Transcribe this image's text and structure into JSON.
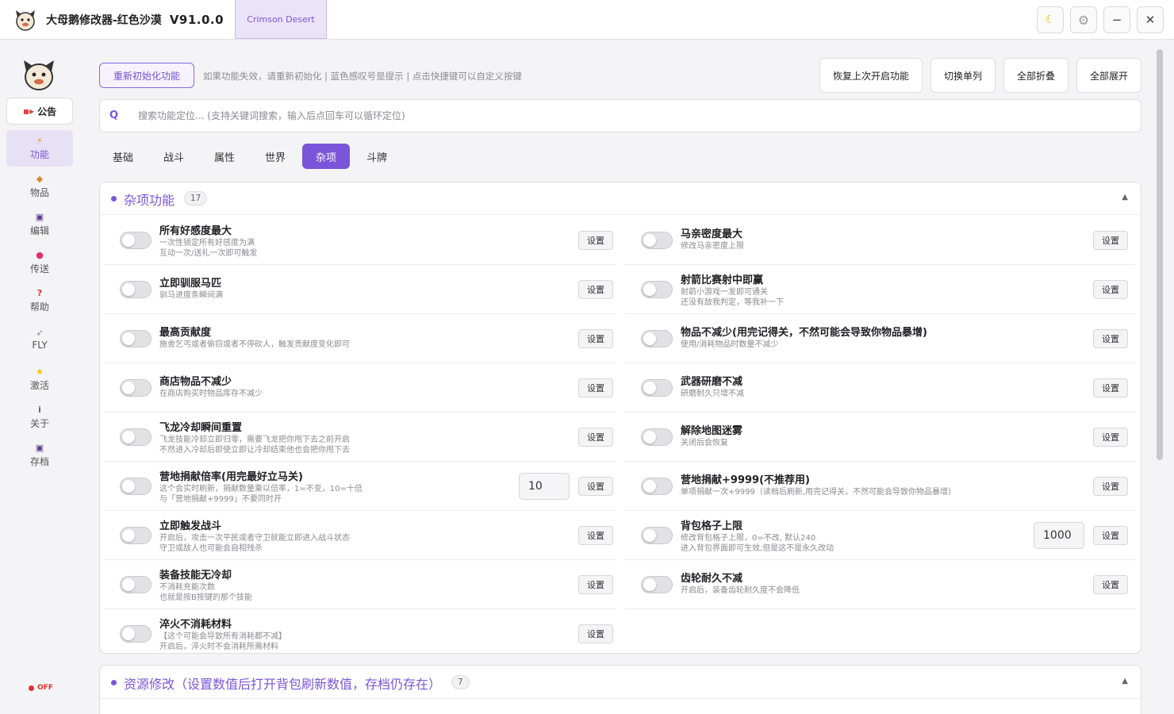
{
  "app": {
    "title": "大母鹅修改器-红色沙漠",
    "version": "V91.0.0",
    "game_tab": "Crimson Desert"
  },
  "window_controls": {
    "theme_icon": "moon-icon",
    "settings_icon": "gear-icon",
    "minimize_icon": "minimize-icon",
    "close_icon": "close-icon"
  },
  "sidebar": {
    "notice_label": "公告",
    "items": [
      {
        "label": "功能",
        "icon": "lightning-icon",
        "active": true
      },
      {
        "label": "物品",
        "icon": "box-icon",
        "active": false
      },
      {
        "label": "编辑",
        "icon": "floppy-icon",
        "active": false
      },
      {
        "label": "传送",
        "icon": "pin-icon",
        "active": false
      },
      {
        "label": "帮助",
        "icon": "question-icon",
        "active": false
      },
      {
        "label": "FLY",
        "icon": "feather-icon",
        "active": false
      },
      {
        "label": "激活",
        "icon": "star-icon",
        "active": false
      },
      {
        "label": "关于",
        "icon": "info-icon",
        "active": false
      },
      {
        "label": "存档",
        "icon": "floppy-icon",
        "active": false
      }
    ],
    "status": "OFF"
  },
  "toolbar": {
    "reinit_label": "重新初始化功能",
    "hint": "如果功能失效，请重新初始化 | 蓝色感叹号是提示 | 点击快捷键可以自定义按键",
    "restore_label": "恢复上次开启功能",
    "single_col_label": "切换单列",
    "collapse_all_label": "全部折叠",
    "expand_all_label": "全部展开"
  },
  "search": {
    "icon_label": "Q",
    "placeholder": "搜索功能定位... (支持关键词搜索，输入后点回车可以循环定位)"
  },
  "tabs": [
    {
      "label": "基础",
      "active": false
    },
    {
      "label": "战斗",
      "active": false
    },
    {
      "label": "属性",
      "active": false
    },
    {
      "label": "世界",
      "active": false
    },
    {
      "label": "杂项",
      "active": true
    },
    {
      "label": "斗牌",
      "active": false
    }
  ],
  "panel": {
    "title": "杂项功能",
    "count": "17",
    "set_label": "设置",
    "left": [
      {
        "title": "所有好感度最大",
        "desc": [
          "一次性锁定所有好感度为满",
          "互动一次/送礼一次即可触发"
        ],
        "value": ""
      },
      {
        "title": "立即驯服马匹",
        "desc": [
          "驯马进度条瞬间满"
        ],
        "value": ""
      },
      {
        "title": "最高贡献度",
        "desc": [
          "施舍乞丐或者偷窃或者不停砍人，触发贡献度变化即可"
        ],
        "value": ""
      },
      {
        "title": "商店物品不减少",
        "desc": [
          "在商店购买时物品库存不减少"
        ],
        "value": ""
      },
      {
        "title": "飞龙冷却瞬间重置",
        "desc": [
          "飞龙技能冷却立即归零，需要飞龙把你甩下去之前开启",
          "不然进入冷却后即使立即让冷却结束他也会把你甩下去"
        ],
        "value": ""
      },
      {
        "title": "营地捐献倍率(用完最好立马关)",
        "desc": [
          "这个会实时刷新，捐献数量乘以倍率，1=不变，10=十倍",
          "与「营地捐献+9999」不要同时开"
        ],
        "value": "10"
      },
      {
        "title": "立即触发战斗",
        "desc": [
          "开启后，攻击一次平民或者守卫就能立即进入战斗状态",
          "守卫或敌人也可能会自相残杀"
        ],
        "value": ""
      },
      {
        "title": "装备技能无冷却",
        "desc": [
          "不消耗充能次数",
          "也就是按B按键的那个技能"
        ],
        "value": ""
      },
      {
        "title": "淬火不消耗材料",
        "desc": [
          "【这个可能会导致所有消耗都不减】",
          "开启后，淬火时不会消耗所需材料"
        ],
        "value": ""
      }
    ],
    "right": [
      {
        "title": "马亲密度最大",
        "desc": [
          "修改马亲密度上限"
        ],
        "value": ""
      },
      {
        "title": "射箭比赛射中即赢",
        "desc": [
          "射箭小游戏一发即可通关",
          "还没有敌我判定，等我补一下"
        ],
        "value": ""
      },
      {
        "title": "物品不减少(用完记得关，不然可能会导致你物品暴增)",
        "desc": [
          "使用/消耗物品时数量不减少"
        ],
        "value": ""
      },
      {
        "title": "武器研磨不减",
        "desc": [
          "研磨耐久只增不减"
        ],
        "value": ""
      },
      {
        "title": "解除地图迷雾",
        "desc": [
          "关闭后会恢复"
        ],
        "value": ""
      },
      {
        "title": "营地捐献+9999(不推荐用)",
        "desc": [
          "单项捐献一次+9999（读档后刷新,用完记得关，不然可能会导致你物品暴增）"
        ],
        "value": ""
      },
      {
        "title": "背包格子上限",
        "desc": [
          "修改背包格子上限，0=不改, 默认240",
          "进入背包界面即可生效,但是这不是永久改动"
        ],
        "value": "1000"
      },
      {
        "title": "齿轮耐久不减",
        "desc": [
          "开启后，装备齿轮耐久度不会降低"
        ],
        "value": ""
      }
    ]
  },
  "panel2": {
    "title": "资源修改（设置数值后打开背包刷新数值，存档仍存在）",
    "count": "7"
  },
  "colors": {
    "accent": "#7b55d9",
    "accent_light": "#e7e1f5",
    "status_off": "#e03030"
  }
}
